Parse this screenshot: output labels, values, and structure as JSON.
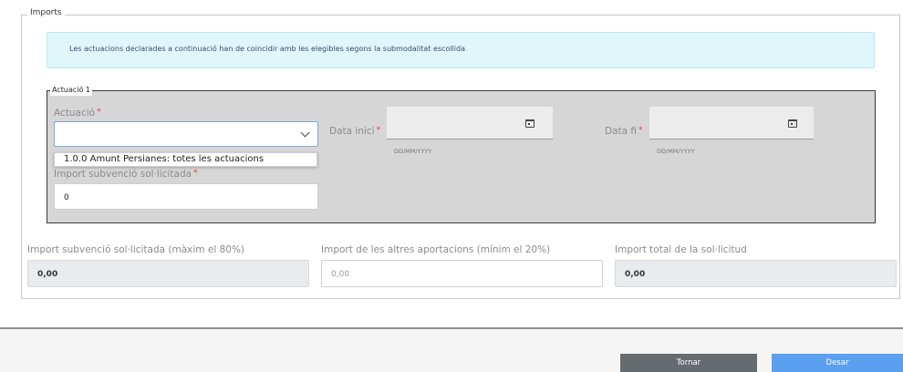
{
  "imports": {
    "legend": "Imports",
    "info": "Les actuacions declarades a continuació han de coincidir amb les elegibles segons la submodalitat escollida"
  },
  "actuacio": {
    "legend": "Actuació 1",
    "field_label": "Actuació",
    "required_mark": "*",
    "select_value": "",
    "dropdown_option": "1.0.0 Amunt Persianes: totes les actuacions",
    "data_inici_label": "Data inici",
    "data_fi_label": "Data fi",
    "date_hint": "DD/MM/YYYY",
    "import_label": "Import subvenció sol·licitada",
    "import_value": "0"
  },
  "totals": {
    "subvencio_label": "Import subvenció sol·licitada (màxim el 80%)",
    "subvencio_value": "0,00",
    "altres_label": "Import de les altres aportacions (mínim el 20%)",
    "altres_placeholder": "0,00",
    "total_label": "Import total de la sol·licitud",
    "total_value": "0,00"
  },
  "footer": {
    "back_label": "Tornar",
    "save_label": "Desar"
  },
  "colors": {
    "back_button": "#666b70",
    "save_button": "#5aa0ef"
  }
}
